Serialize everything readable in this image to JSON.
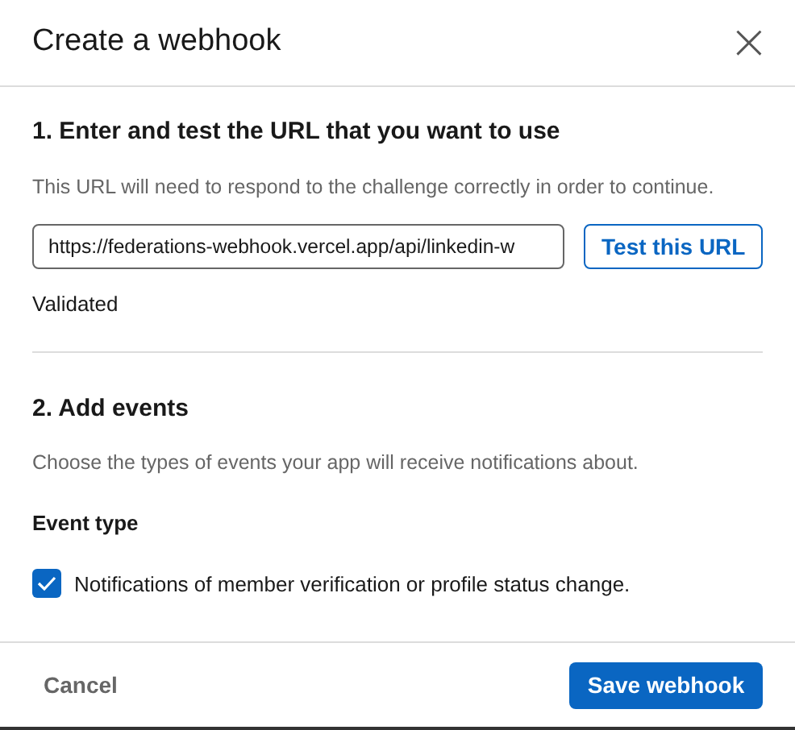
{
  "dialog": {
    "title": "Create a webhook",
    "close": "×"
  },
  "step_1": {
    "heading": "1. Enter and test the URL that you want to use",
    "description": "This URL will need to respond to the challenge correctly in order to continue.",
    "url_field": {
      "value": "https://federations-webhook.vercel.app/api/linkedin-w"
    },
    "test_button": "Test this URL",
    "status": "Validated"
  },
  "step_2": {
    "heading": "2. Add events",
    "description": "Choose the types of events your app will receive notifications about.",
    "event_type_label": "Event type",
    "events": [
      {
        "label": "Notifications of member verification or profile status change.",
        "checked": true
      }
    ]
  },
  "footer": {
    "cancel": "Cancel",
    "save": "Save webhook"
  }
}
